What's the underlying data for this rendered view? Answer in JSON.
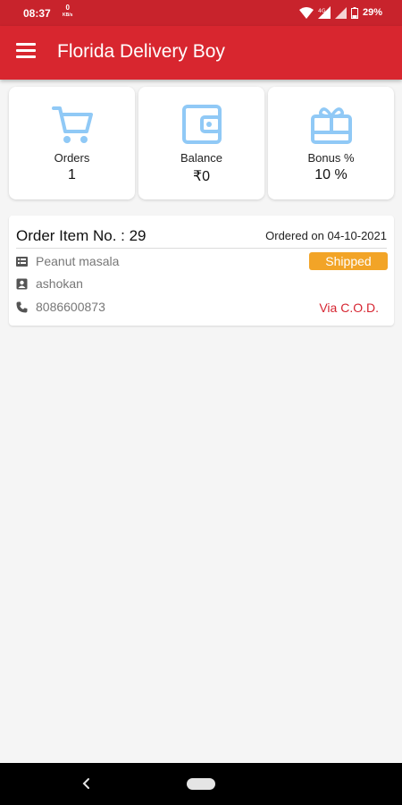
{
  "status_bar": {
    "time": "08:37",
    "net_speed": "0",
    "net_speed_unit": "KB/s",
    "battery_percent": "29%"
  },
  "app_bar": {
    "title": "Florida Delivery Boy",
    "background_color": "#d8262f"
  },
  "stats": [
    {
      "label": "Orders",
      "value": "1",
      "icon": "cart-icon"
    },
    {
      "label": "Balance",
      "value": "₹0",
      "icon": "wallet-icon"
    },
    {
      "label": "Bonus %",
      "value": "10 %",
      "icon": "gift-card-icon"
    }
  ],
  "accent_icon_color": "#90c9f6",
  "order": {
    "item_no": "Order Item No. : 29",
    "ordered_on": "Ordered on 04-10-2021",
    "product": "Peanut masala",
    "customer": "ashokan",
    "phone": "8086600873",
    "status": "Shipped",
    "status_color": "#f2a427",
    "payment": "Via C.O.D.",
    "payment_color": "#d62531"
  }
}
